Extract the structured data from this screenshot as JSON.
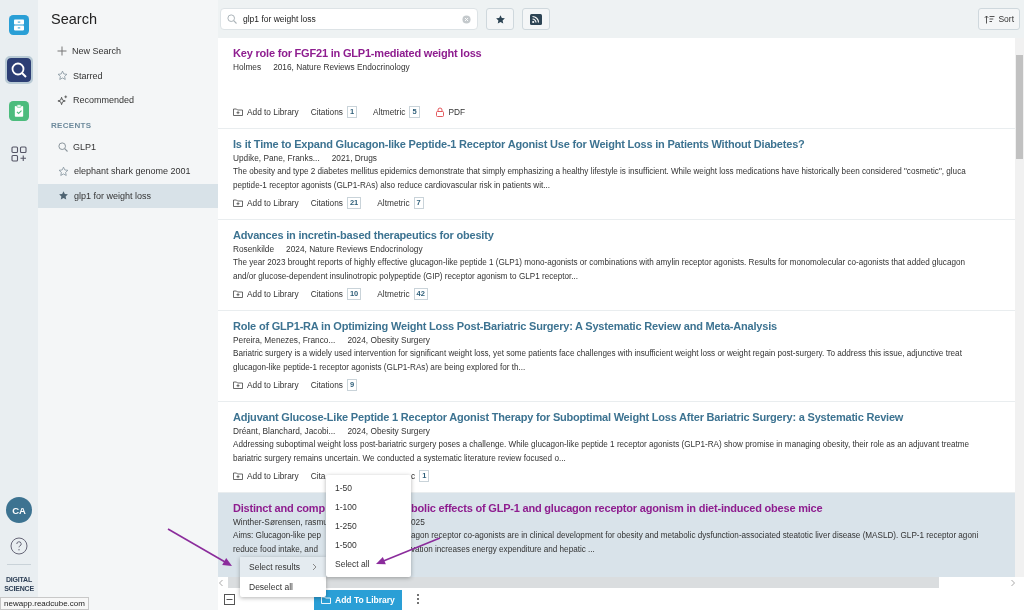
{
  "rail": {
    "items": [
      {
        "selected": false
      },
      {
        "selected": true
      },
      {
        "selected": false
      },
      {
        "selected": false
      }
    ],
    "avatar": "CA",
    "brand": [
      "DIGITAL",
      "SCIENCE"
    ]
  },
  "sidebar": {
    "title": "Search",
    "items": [
      {
        "kind": "new",
        "label": "New Search"
      },
      {
        "kind": "starred",
        "label": "Starred"
      },
      {
        "kind": "recommended",
        "label": "Recommended"
      }
    ],
    "recents_heading": "RECENTS",
    "recents": [
      {
        "kind": "query",
        "label": "GLP1",
        "selected": false
      },
      {
        "kind": "saved",
        "label": "elephant shark genome 2001",
        "selected": false
      },
      {
        "kind": "starred",
        "label": "glp1 for weight loss",
        "selected": true
      }
    ]
  },
  "toolbar": {
    "search": {
      "value": "glp1 for weight loss"
    },
    "sort": "Sort"
  },
  "results": [
    {
      "title": "Key role for FGF21 in GLP1-mediated weight loss",
      "visited": true,
      "selected": false,
      "authors": "Holmes",
      "source": "2016, Nature Reviews Endocrinology",
      "actions": [
        {
          "kind": "add",
          "label": "Add to Library"
        },
        {
          "kind": "metric",
          "label": "Citations",
          "count": "1"
        },
        {
          "kind": "metric",
          "label": "Altmetric",
          "count": "5"
        },
        {
          "kind": "pdf",
          "label": "PDF"
        }
      ]
    },
    {
      "title": "Is it Time to Expand Glucagon-like Peptide-1 Receptor Agonist Use for Weight Loss in Patients Without Diabetes?",
      "visited": false,
      "selected": false,
      "authors": "Updike, Pane, Franks...",
      "source": "2021, Drugs",
      "abstract": [
        "The obesity and type 2 diabetes mellitus epidemics demonstrate that simply emphasizing a healthy lifestyle is insufficient. While weight loss medications have historically been considered \"cosmetic\", gluca",
        "peptide-1 receptor agonists (GLP1-RAs) also reduce cardiovascular risk in patients wit..."
      ],
      "actions": [
        {
          "kind": "add",
          "label": "Add to Library"
        },
        {
          "kind": "metric",
          "label": "Citations",
          "count": "21"
        },
        {
          "kind": "metric",
          "label": "Altmetric",
          "count": "7"
        }
      ]
    },
    {
      "title": "Advances in incretin-based therapeutics for obesity",
      "visited": false,
      "selected": false,
      "authors": "Rosenkilde",
      "source": "2024, Nature Reviews Endocrinology",
      "abstract": [
        "The year 2023 brought reports of highly effective glucagon-like peptide 1 (GLP1) mono-agonists or combinations with amylin receptor agonists. Results for monomolecular co-agonists that added glucagon",
        "and/or glucose-dependent insulinotropic polypeptide (GIP) receptor agonism to GLP1 receptor..."
      ],
      "actions": [
        {
          "kind": "add",
          "label": "Add to Library"
        },
        {
          "kind": "metric",
          "label": "Citations",
          "count": "10"
        },
        {
          "kind": "metric",
          "label": "Altmetric",
          "count": "42"
        }
      ]
    },
    {
      "title": "Role of GLP1-RA in Optimizing Weight Loss Post-Bariatric Surgery: A Systematic Review and Meta-Analysis",
      "visited": false,
      "selected": false,
      "authors": "Pereira, Menezes, Franco...",
      "source": "2024, Obesity Surgery",
      "abstract": [
        "Bariatric surgery is a widely used intervention for significant weight loss, yet some patients face challenges with insufficient weight loss or weight regain post-surgery. To address this issue, adjunctive treat",
        "glucagon-like peptide-1 receptor agonists (GLP1-RAs) are being explored for th..."
      ],
      "actions": [
        {
          "kind": "add",
          "label": "Add to Library"
        },
        {
          "kind": "metric",
          "label": "Citations",
          "count": "9"
        }
      ]
    },
    {
      "title": "Adjuvant Glucose-Like Peptide 1 Receptor Agonist Therapy for Suboptimal Weight Loss After Bariatric Surgery: a Systematic Review",
      "visited": false,
      "selected": false,
      "authors": "Dréant, Blanchard, Jacobi...",
      "source": "2024, Obesity Surgery",
      "abstract": [
        "Addressing suboptimal weight loss post-bariatric surgery poses a challenge. While glucagon-like peptide 1 receptor agonists (GLP1-RA) show promise in managing obesity, their role as an adjuvant treatme",
        "bariatric surgery remains uncertain. We conducted a systematic literature review focused o..."
      ],
      "actions": [
        {
          "kind": "add",
          "label": "Add to Library"
        },
        {
          "kind": "text",
          "label": "Cita"
        }
      ],
      "actions_after": [
        {
          "kind": "metric",
          "label": "c",
          "count": "1"
        }
      ]
    },
    {
      "title": [
        "Distinct and comp",
        "bolic effects of GLP-1 and glucagon receptor agonism in diet-induced obese mice"
      ],
      "visited": true,
      "selected": true,
      "cover": true,
      "authors": "Winther-Sørensen, rasmu",
      "source": "025",
      "abstract": [
        [
          "Aims: Glucagon-like pep",
          "agon receptor co-agonists are in clinical development for obesity and metabolic dysfunction-associated steatotic liver disease (MASLD). GLP-1 receptor agoni"
        ],
        [
          "reduce food intake, and",
          "vation increases energy expenditure and hepatic ..."
        ]
      ]
    }
  ],
  "bottom_bar": {
    "select_all_checkbox": {
      "indeterminate": true
    },
    "add_button": "Add To Library"
  },
  "context_menu": {
    "items": [
      {
        "label": "Select results",
        "has_submenu": true,
        "selected": true
      },
      {
        "label": "Deselect all",
        "has_submenu": false,
        "selected": false
      }
    ]
  },
  "submenu": {
    "items": [
      {
        "label": "1-50"
      },
      {
        "label": "1-100"
      },
      {
        "label": "1-250"
      },
      {
        "label": "1-500"
      },
      {
        "label": "Select all"
      }
    ]
  },
  "status_tooltip": "newapp.readcube.com"
}
